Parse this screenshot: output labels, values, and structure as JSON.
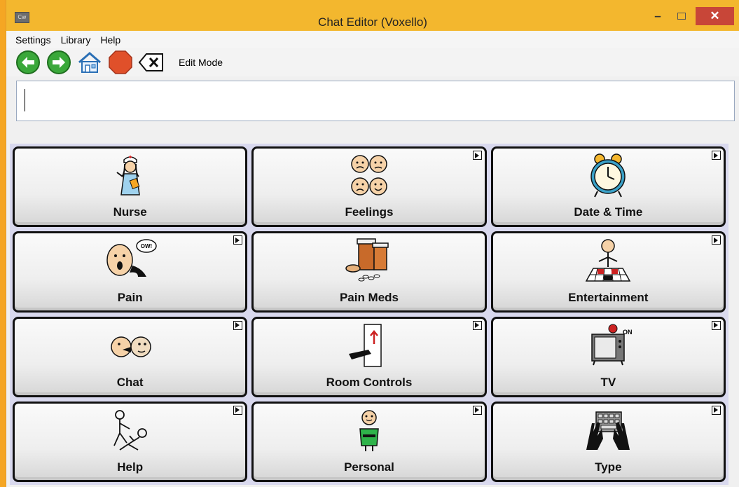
{
  "window": {
    "title": "Chat Editor (Voxello)",
    "app_icon_text": "Cw"
  },
  "menu": {
    "items": [
      "Settings",
      "Library",
      "Help"
    ]
  },
  "toolbar": {
    "mode_label": "Edit Mode",
    "icons": [
      "back-arrow-icon",
      "forward-arrow-icon",
      "home-icon",
      "stop-icon",
      "backspace-icon"
    ]
  },
  "message_bar": {
    "value": ""
  },
  "tiles": [
    {
      "label": "Nurse",
      "icon": "nurse-icon",
      "has_submenu": false
    },
    {
      "label": "Feelings",
      "icon": "feelings-faces-icon",
      "has_submenu": true
    },
    {
      "label": "Date & Time",
      "icon": "alarm-clock-icon",
      "has_submenu": true
    },
    {
      "label": "Pain",
      "icon": "pain-face-icon",
      "has_submenu": true
    },
    {
      "label": "Pain Meds",
      "icon": "pill-bottles-icon",
      "has_submenu": false
    },
    {
      "label": "Entertainment",
      "icon": "checkers-player-icon",
      "has_submenu": true
    },
    {
      "label": "Chat",
      "icon": "two-faces-chat-icon",
      "has_submenu": true
    },
    {
      "label": "Room Controls",
      "icon": "light-switch-icon",
      "has_submenu": true
    },
    {
      "label": "TV",
      "icon": "tv-icon",
      "has_submenu": true
    },
    {
      "label": "Help",
      "icon": "helping-person-icon",
      "has_submenu": true
    },
    {
      "label": "Personal",
      "icon": "personal-person-icon",
      "has_submenu": true
    },
    {
      "label": "Type",
      "icon": "keyboard-hands-icon",
      "has_submenu": true
    }
  ],
  "colors": {
    "titlebar": "#f3b72e",
    "close": "#c84638",
    "grid_bg": "#d9d9ee",
    "green_arrow": "#3aa83a",
    "stop": "#e0502a"
  }
}
